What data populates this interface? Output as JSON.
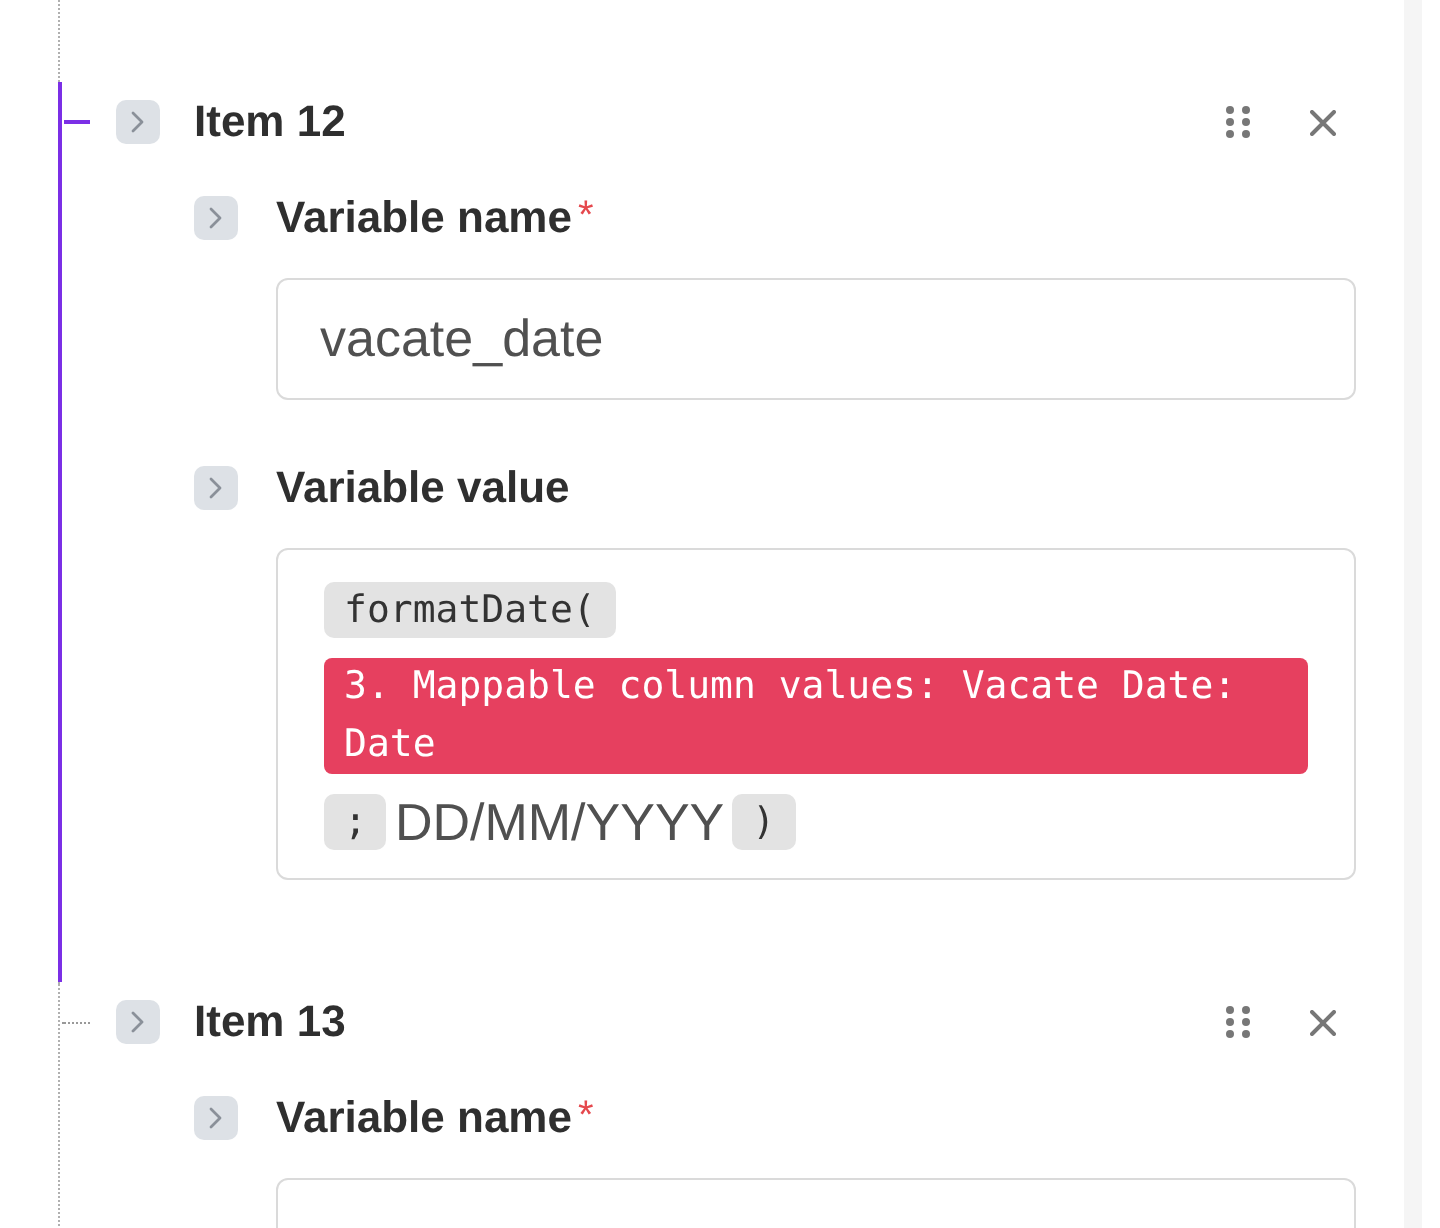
{
  "items": [
    {
      "title": "Item 12",
      "selected": true,
      "fields": [
        {
          "kind": "text",
          "label": "Variable name",
          "required_mark": "*",
          "value": "vacate_date"
        },
        {
          "kind": "expression",
          "label": "Variable value",
          "tokens": [
            {
              "kind": "code",
              "text": "formatDate("
            },
            {
              "kind": "mapping",
              "text": "3. Mappable column values: Vacate Date: Date"
            },
            {
              "kind": "code",
              "text": ";"
            },
            {
              "kind": "text",
              "text": "DD/MM/YYYY"
            },
            {
              "kind": "code",
              "text": ")"
            }
          ]
        }
      ]
    },
    {
      "title": "Item 13",
      "selected": false,
      "fields": [
        {
          "kind": "text",
          "label": "Variable name",
          "required_mark": "*"
        }
      ]
    }
  ]
}
